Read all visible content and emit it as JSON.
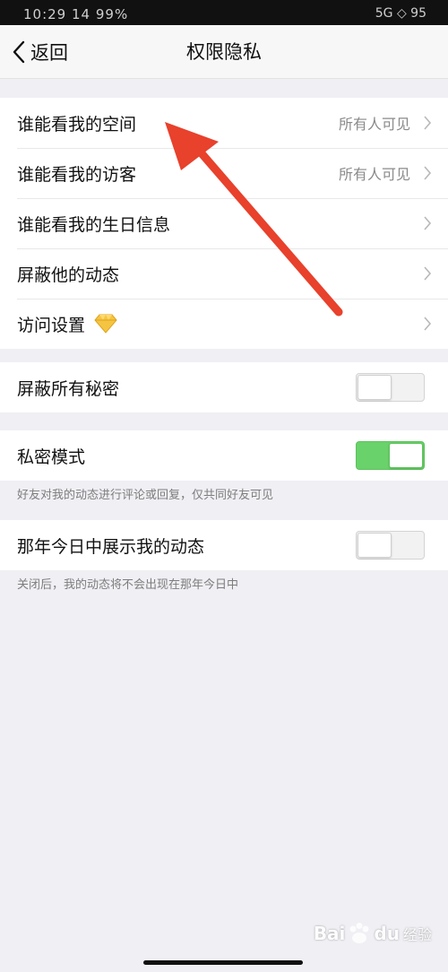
{
  "status_bar": {
    "time": "10:29 14 99% ",
    "right": "5G ◇ 95"
  },
  "nav": {
    "back_label": "返回",
    "title": "权限隐私"
  },
  "group1": [
    {
      "label": "谁能看我的空间",
      "value": "所有人可见"
    },
    {
      "label": "谁能看我的访客",
      "value": "所有人可见"
    },
    {
      "label": "谁能看我的生日信息",
      "value": ""
    },
    {
      "label": "屏蔽他的动态",
      "value": ""
    },
    {
      "label": "访问设置",
      "value": "",
      "icon": "diamond-icon"
    }
  ],
  "hide_secrets": {
    "label": "屏蔽所有秘密",
    "on": false
  },
  "private_mode": {
    "label": "私密模式",
    "on": true,
    "note": "好友对我的动态进行评论或回复，仅共同好友可见"
  },
  "memories": {
    "label": "那年今日中展示我的动态",
    "on": false,
    "note": "关闭后，我的动态将不会出现在那年今日中"
  },
  "watermark": {
    "brand_a": "Bai",
    "brand_b": "du",
    "suffix": "经验"
  },
  "colors": {
    "toggle_on": "#6ad26a",
    "arrow": "#e8412c",
    "diamond": "#f5c542"
  }
}
